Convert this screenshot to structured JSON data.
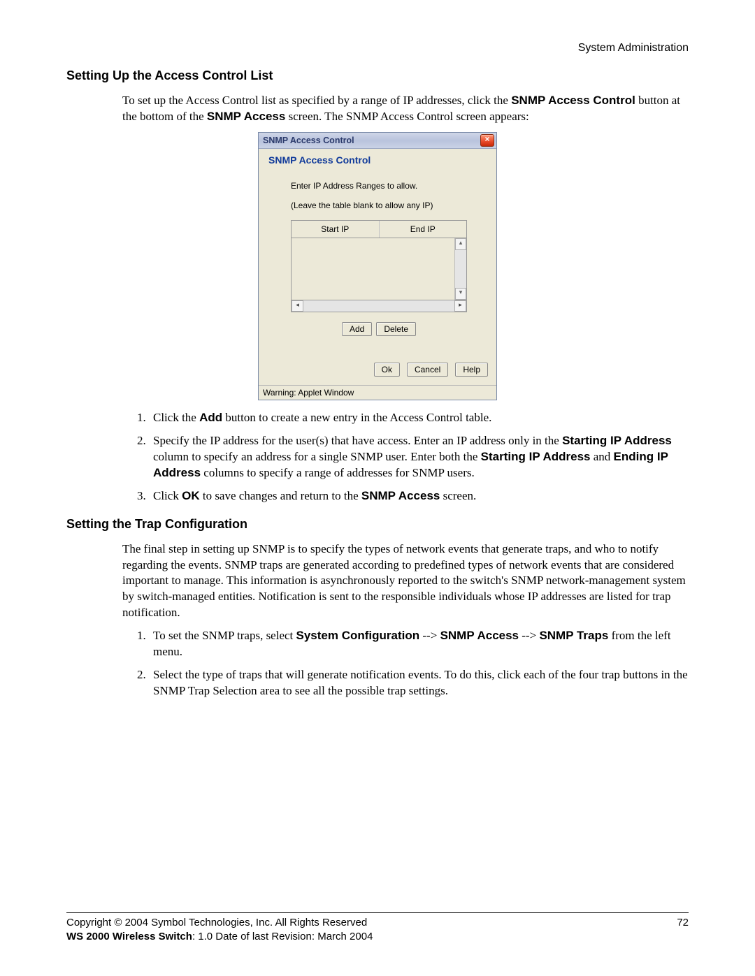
{
  "header": {
    "section": "System Administration"
  },
  "section1": {
    "heading": "Setting Up the Access Control List",
    "intro_parts": {
      "p1a": "To set up the Access Control list as specified by a range of IP addresses, click the ",
      "b1": "SNMP Access Control",
      "p1b": " button at the bottom of the ",
      "b2": "SNMP Access",
      "p1c": " screen. The SNMP Access Control screen appears:"
    },
    "steps": {
      "s1a": "Click the ",
      "s1b": "Add",
      "s1c": " button to create a new entry in the Access Control table.",
      "s2a": "Specify the IP address for the user(s) that have access. Enter an IP address only in the ",
      "s2b": "Starting IP Address",
      "s2c": " column to specify an address for a single SNMP user. Enter both the ",
      "s2d": "Starting IP Address",
      "s2e": " and ",
      "s2f": "Ending IP Address",
      "s2g": " columns to specify a range of addresses for SNMP users.",
      "s3a": "Click ",
      "s3b": "OK",
      "s3c": " to save changes and return to the ",
      "s3d": "SNMP Access",
      "s3e": " screen."
    }
  },
  "dialog": {
    "title": "SNMP Access Control",
    "panel_title": "SNMP Access Control",
    "hint1": "Enter IP Address Ranges to allow.",
    "hint2": "(Leave the table blank to allow any IP)",
    "col_start": "Start IP",
    "col_end": "End IP",
    "add": "Add",
    "delete": "Delete",
    "ok": "Ok",
    "cancel": "Cancel",
    "help": "Help",
    "status": "Warning: Applet Window"
  },
  "section2": {
    "heading": "Setting the Trap Configuration",
    "para": "The final step in setting up SNMP is to specify the types of network events that generate traps, and who to notify regarding the events. SNMP traps are generated according to predefined types of network events that are considered important to manage. This information is asynchronously reported to the switch's SNMP network-management system by switch-managed entities. Notification is sent to the responsible individuals whose IP addresses are listed for trap notification.",
    "steps": {
      "s1a": "To set the SNMP traps, select ",
      "s1b": "System Configuration",
      "s1c": " --> ",
      "s1d": "SNMP Access",
      "s1e": " --> ",
      "s1f": "SNMP Traps",
      "s1g": " from the left menu.",
      "s2": "Select the type of traps that will generate notification events. To do this, click each of the four trap buttons in the SNMP Trap Selection area to see all the possible trap settings."
    }
  },
  "footer": {
    "line1": "Copyright © 2004 Symbol Technologies, Inc. All Rights Reserved",
    "line2_bold": "WS 2000 Wireless Switch",
    "line2_rest": ": 1.0  Date of last Revision: March 2004",
    "page": "72"
  }
}
